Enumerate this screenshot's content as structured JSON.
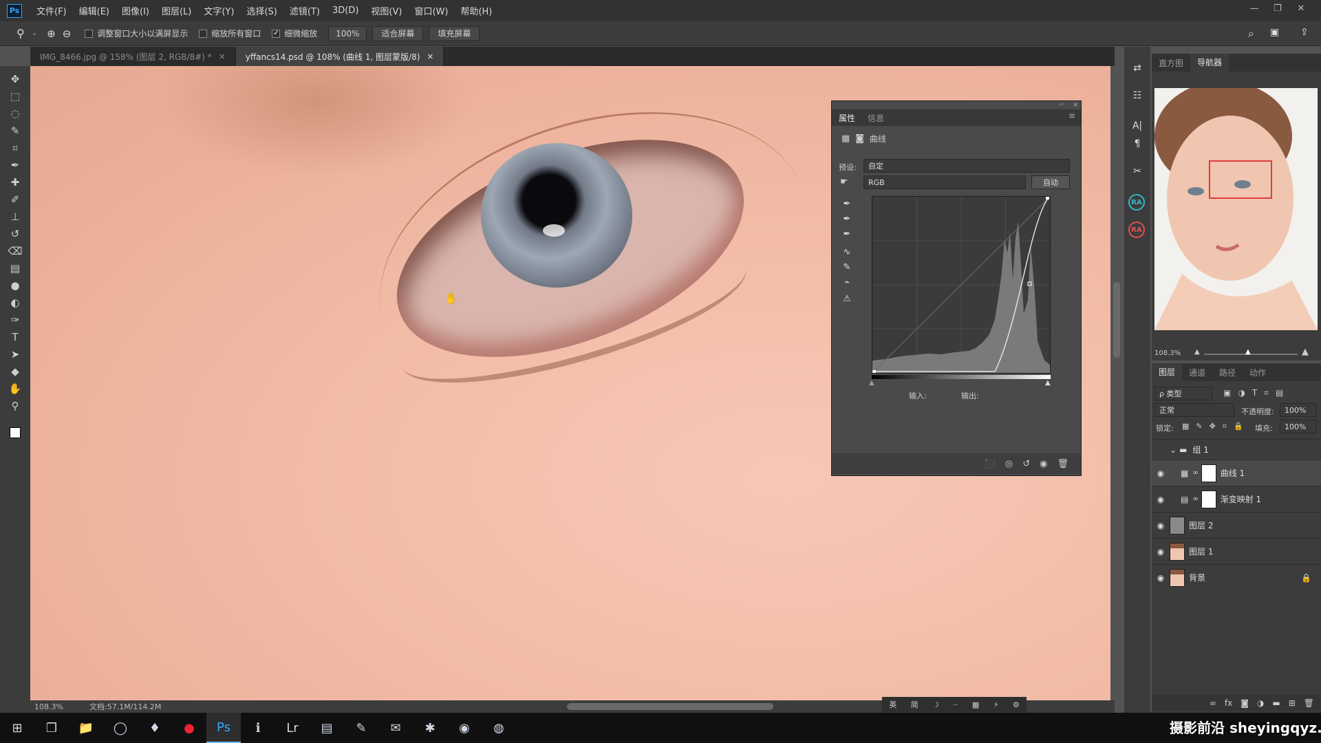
{
  "app": {
    "logo": "Ps"
  },
  "menubar": {
    "items": [
      "文件(F)",
      "编辑(E)",
      "图像(I)",
      "图层(L)",
      "文字(Y)",
      "选择(S)",
      "滤镜(T)",
      "3D(D)",
      "视图(V)",
      "窗口(W)",
      "帮助(H)"
    ]
  },
  "window_controls": {
    "minimize": "—",
    "restore": "❐",
    "close": "✕"
  },
  "options": {
    "resize_windows": "调整窗口大小以满屏显示",
    "zoom_all": "缩放所有窗口",
    "scrubby_zoom": "细微缩放",
    "zoom_value": "100%",
    "fit_screen": "适合屏幕",
    "fill_screen": "填充屏幕"
  },
  "tabs": [
    {
      "label": "IMG_8466.jpg @ 158% (图层 2, RGB/8#) *",
      "active": false
    },
    {
      "label": "yffancs14.psd @ 108% (曲线 1, 图层蒙版/8)",
      "active": true
    }
  ],
  "tab_close": "×",
  "tools": [
    "move-icon",
    "marquee-icon",
    "lasso-icon",
    "quick-select-icon",
    "crop-icon",
    "eyedropper-icon",
    "spot-heal-icon",
    "brush-icon",
    "stamp-icon",
    "history-brush-icon",
    "eraser-icon",
    "gradient-icon",
    "blur-icon",
    "dodge-icon",
    "pen-icon",
    "type-icon",
    "path-select-icon",
    "shape-icon",
    "hand-icon",
    "zoom-icon"
  ],
  "tool_glyphs": [
    "✥",
    "⬚",
    "◌",
    "✎",
    "⌗",
    "✒",
    "✚",
    "✐",
    "⊥",
    "↺",
    "⌫",
    "▤",
    "●",
    "◐",
    "✑",
    "T",
    "➤",
    "◆",
    "✋",
    "⚲"
  ],
  "status": {
    "zoom": "108.3%",
    "doc": "文档:57.1M/114.2M"
  },
  "ime": [
    "英",
    "简",
    "☽",
    "··",
    "▦",
    "⚡",
    "⚙"
  ],
  "properties": {
    "tabs": [
      "属性",
      "信息"
    ],
    "type_label": "曲线",
    "preset_label": "预设:",
    "preset_value": "自定",
    "channel_value": "RGB",
    "auto_button": "自动",
    "input_label": "输入:",
    "output_label": "输出:",
    "collapse": "‹‹",
    "close": "×",
    "menu": "≡"
  },
  "right_strip": {
    "ra1": "RA",
    "ra2": "RA"
  },
  "navigator": {
    "tabs": [
      "直方图",
      "导航器"
    ],
    "zoom": "108.3%"
  },
  "layers": {
    "tabs": [
      "图层",
      "通道",
      "路径",
      "动作"
    ],
    "filter_label": "ρ 类型",
    "blend_mode": "正常",
    "opacity_label": "不透明度:",
    "opacity_value": "100%",
    "lock_label": "锁定:",
    "fill_label": "填充:",
    "fill_value": "100%",
    "items": [
      {
        "name": "组 1",
        "kind": "group"
      },
      {
        "name": "曲线 1",
        "kind": "adjustment"
      },
      {
        "name": "渐变映射 1",
        "kind": "adjustment"
      },
      {
        "name": "图层 2",
        "kind": "pixel"
      },
      {
        "name": "图层 1",
        "kind": "pixel"
      },
      {
        "name": "背景",
        "kind": "background"
      }
    ]
  },
  "watermark": {
    "text": "摄影前沿 sheyingqyz.com"
  },
  "taskbar": {
    "apps": [
      "start-icon",
      "task-view-icon",
      "file-explorer-icon",
      "browser-icon",
      "app-icon",
      "record-icon",
      "photoshop-icon",
      "info-icon",
      "lightroom-icon",
      "notes-icon",
      "app2-icon",
      "mail-icon",
      "app3-icon",
      "app4-icon",
      "app5-icon"
    ]
  }
}
